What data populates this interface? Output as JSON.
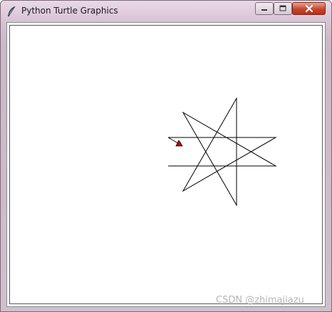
{
  "window": {
    "title": "Python Turtle Graphics",
    "icon": "feather-icon",
    "controls": {
      "minimize_icon": "minimize-icon",
      "maximize_icon": "maximize-icon",
      "close_icon": "close-icon"
    },
    "close_color": "#c8452c"
  },
  "canvas": {
    "background": "#ffffff",
    "pen_color": "#000000",
    "turtle_color": "#cc0000"
  },
  "watermark": {
    "text": "CSDN @zhimajiazu"
  }
}
